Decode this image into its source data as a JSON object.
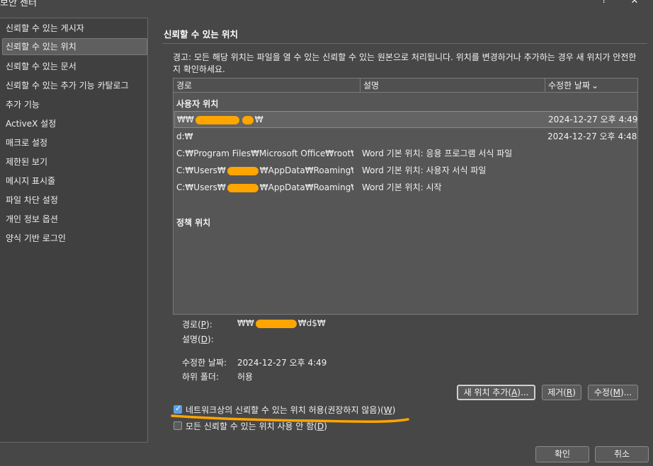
{
  "window": {
    "title": "보안 센터",
    "help": "?",
    "close": "✕"
  },
  "sidebar": {
    "items": [
      {
        "label": "신뢰할 수 있는 게시자"
      },
      {
        "label": "신뢰할 수 있는 위치",
        "selected": true
      },
      {
        "label": "신뢰할 수 있는 문서"
      },
      {
        "label": "신뢰할 수 있는 추가 기능 카탈로그"
      },
      {
        "label": "추가 기능"
      },
      {
        "label": "ActiveX 설정"
      },
      {
        "label": "매크로 설정"
      },
      {
        "label": "제한된 보기"
      },
      {
        "label": "메시지 표시줄"
      },
      {
        "label": "파일 차단 설정"
      },
      {
        "label": "개인 정보 옵션"
      },
      {
        "label": "양식 기반 로그인"
      }
    ]
  },
  "main": {
    "title": "신뢰할 수 있는 위치",
    "warning": "경고: 모든 해당 위치는 파일을 열 수 있는 신뢰할 수 있는 원본으로 처리됩니다. 위치를 변경하거나 추가하는 경우 새 위치가 안전한지 확인하세요.",
    "columns": {
      "path": "경로",
      "description": "설명",
      "modified": "수정한 날짜",
      "sort_icon": "⌄"
    },
    "user_group": "사용자 위치",
    "policy_group": "정책 위치",
    "rows": [
      {
        "path_prefix": "₩₩",
        "path_suffix": "₩",
        "description": "",
        "modified": "2024-12-27 오후 4:49"
      },
      {
        "path_prefix": "d:₩",
        "path_suffix": "",
        "description": "",
        "modified": "2024-12-27 오후 4:48"
      },
      {
        "path_prefix": "C:₩Program Files₩Microsoft Office₩root₩Te",
        "path_suffix": "",
        "description": "Word 기본 위치: 응용 프로그램 서식 파일",
        "modified": ""
      },
      {
        "path_prefix": "C:₩Users₩",
        "path_suffix": "₩AppData₩Roaming₩Micr",
        "description": "Word 기본 위치: 사용자 서식 파일",
        "modified": ""
      },
      {
        "path_prefix": "C:₩Users₩",
        "path_suffix": "₩AppData₩Roaming₩Micr",
        "description": "Word 기본 위치: 시작",
        "modified": ""
      }
    ],
    "details": {
      "path_label": "경로(",
      "path_key": "P",
      "path_label_end": "):",
      "path_value_prefix": "₩₩",
      "path_value_suffix": "₩d$₩",
      "desc_label": "설명(",
      "desc_key": "D",
      "desc_label_end": "):",
      "modified_label": "수정한 날짜:",
      "modified_value": "2024-12-27 오후 4:49",
      "subfolders_label": "하위 폴더:",
      "subfolders_value": "허용"
    },
    "buttons": {
      "add": "새 위치 추가(",
      "add_key": "A",
      "add_end": ")...",
      "remove": "제거(",
      "remove_key": "R",
      "remove_end": ")",
      "modify": "수정(",
      "modify_key": "M",
      "modify_end": ")..."
    },
    "checkboxes": {
      "network_label": "네트워크상의 신뢰할 수 있는 위치 허용(권장하지 않음)(",
      "network_key": "W",
      "network_end": ")",
      "network_checked": true,
      "disable_label": "모든 신뢰할 수 있는 위치 사용 안 함(",
      "disable_key": "D",
      "disable_end": ")",
      "disable_checked": false
    }
  },
  "footer": {
    "ok": "확인",
    "cancel": "취소"
  },
  "annotation": {
    "highlight_color": "#ffa500"
  }
}
